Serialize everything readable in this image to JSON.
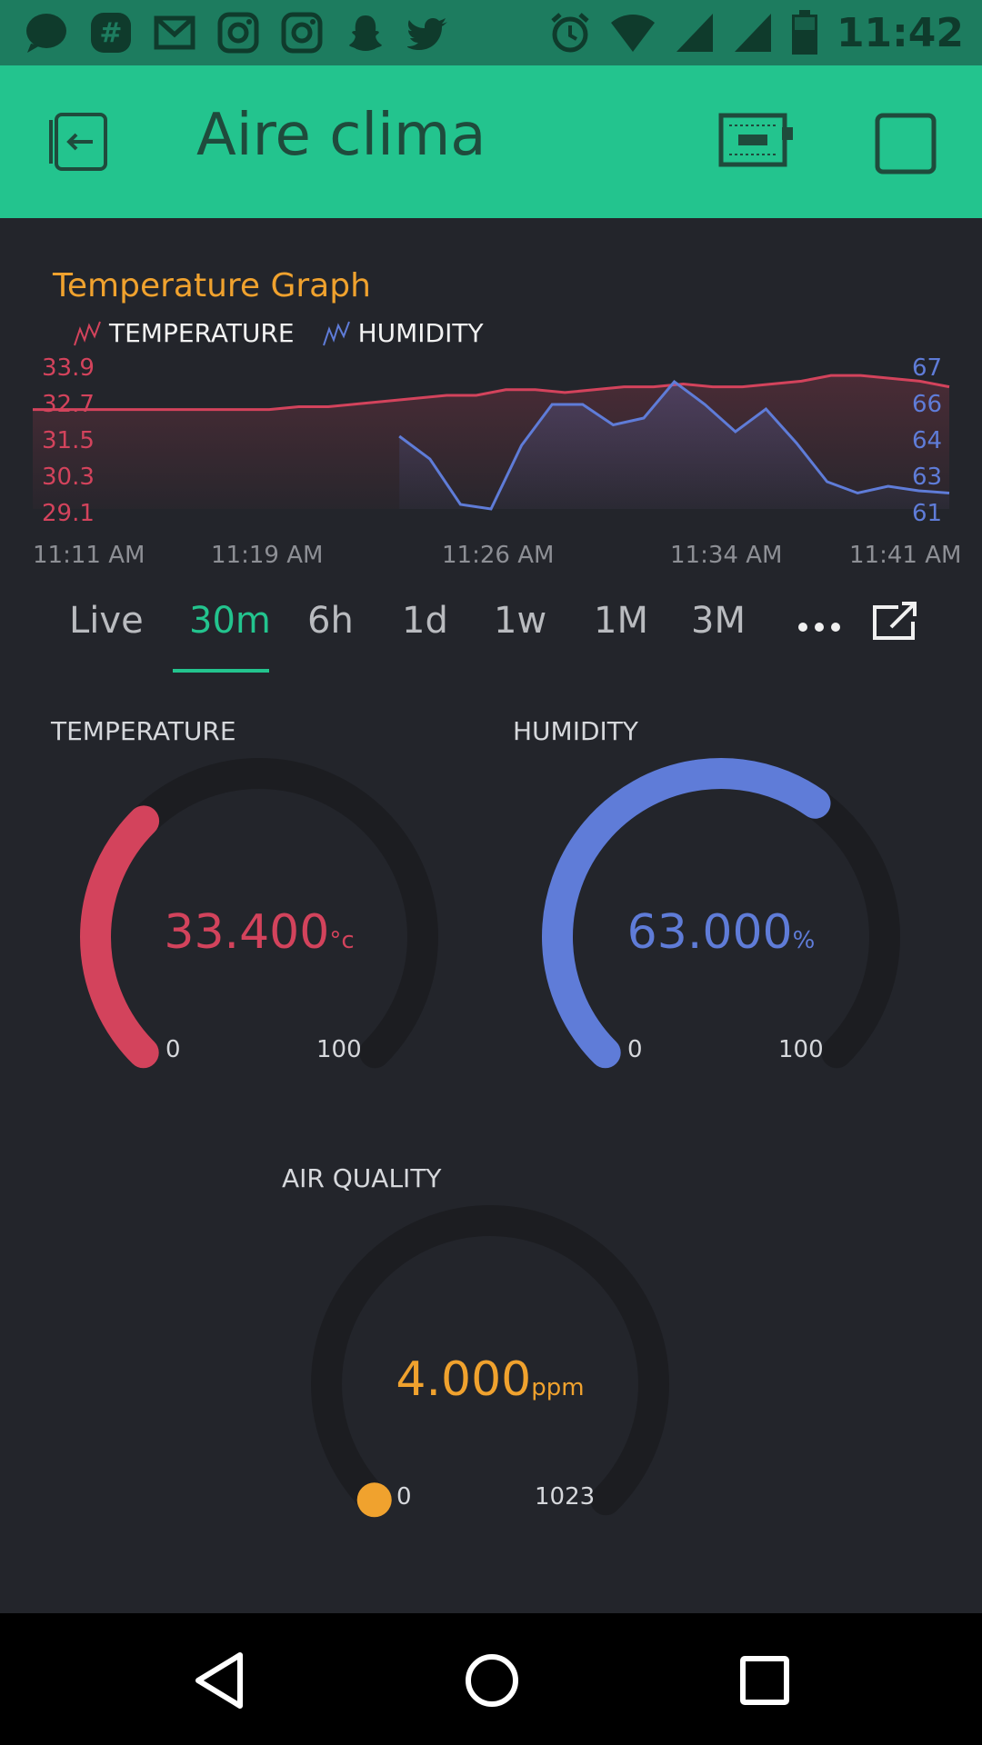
{
  "status_bar": {
    "time": "11:42",
    "notification_icons": [
      "messenger-icon",
      "slack-icon",
      "gmail-icon",
      "instagram-icon",
      "instagram-icon",
      "snapchat-icon",
      "twitter-icon"
    ],
    "system_icons": [
      "alarm-icon",
      "wifi-icon",
      "signal-icon",
      "signal-icon",
      "battery-icon"
    ]
  },
  "header": {
    "title": "Aire clima",
    "bg_color": "#23c48e",
    "icons": [
      "exit-icon",
      "device-icon",
      "stop-icon"
    ]
  },
  "graph": {
    "title": "Temperature Graph",
    "legend": [
      "TEMPERATURE",
      "HUMIDITY"
    ],
    "y_left_ticks": [
      "33.9",
      "32.7",
      "31.5",
      "30.3",
      "29.1"
    ],
    "y_right_ticks": [
      "67",
      "66",
      "64",
      "63",
      "61"
    ],
    "x_ticks": [
      "11:11 AM",
      "11:19 AM",
      "11:26 AM",
      "11:34 AM",
      "11:41 AM"
    ]
  },
  "chart_data": {
    "type": "line",
    "x_range": [
      "11:11 AM",
      "11:41 AM"
    ],
    "series": [
      {
        "name": "TEMPERATURE",
        "color": "#d3435c",
        "axis": "left",
        "ylim": [
          29.1,
          33.9
        ],
        "values": [
          32.6,
          32.6,
          32.6,
          32.6,
          32.6,
          32.6,
          32.6,
          32.6,
          32.6,
          32.7,
          32.7,
          32.8,
          32.9,
          33.0,
          33.1,
          33.1,
          33.3,
          33.3,
          33.2,
          33.3,
          33.4,
          33.4,
          33.5,
          33.4,
          33.4,
          33.5,
          33.6,
          33.8,
          33.8,
          33.7,
          33.6,
          33.4
        ]
      },
      {
        "name": "HUMIDITY",
        "color": "#5f7cd8",
        "axis": "right",
        "ylim": [
          61,
          67
        ],
        "values": [
          null,
          null,
          null,
          null,
          null,
          null,
          null,
          null,
          null,
          null,
          null,
          null,
          64.2,
          63.2,
          61.2,
          61.0,
          63.8,
          65.6,
          65.6,
          64.7,
          65.0,
          66.6,
          65.6,
          64.4,
          65.4,
          63.9,
          62.2,
          61.7,
          62.0,
          61.8,
          61.7
        ]
      }
    ]
  },
  "range_tabs": [
    "Live",
    "30m",
    "6h",
    "1d",
    "1w",
    "1M",
    "3M"
  ],
  "range_active": "30m",
  "gauges": [
    {
      "label": "TEMPERATURE",
      "value": "33.400",
      "unit": "°c",
      "min": "0",
      "max": "100",
      "level": 0.334,
      "color": "#d3435c"
    },
    {
      "label": "HUMIDITY",
      "value": "63.000",
      "unit": "%",
      "min": "0",
      "max": "100",
      "level": 0.63,
      "color": "#5f7cd8"
    },
    {
      "label": "AIR QUALITY",
      "value": "4.000",
      "unit": "ppm",
      "min": "0",
      "max": "1023",
      "level": 0.004,
      "color": "#f0a22e"
    }
  ],
  "nav": [
    "back-icon",
    "home-icon",
    "recents-icon"
  ]
}
